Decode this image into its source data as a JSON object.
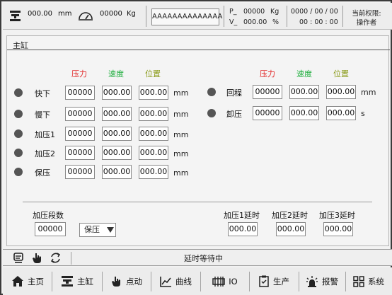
{
  "header": {
    "pressure_value": "000.00",
    "pressure_unit": "mm",
    "weight_value": "00000",
    "weight_unit": "Kg",
    "model_name": "AAAAAAAAAAAAAA",
    "p_label": "P_",
    "p_value": "00000",
    "p_unit": "Kg",
    "v_label": "V_",
    "v_value": "000.00",
    "v_unit": "%",
    "date": "0000 / 00 / 00",
    "time": "00 : 00 : 00",
    "permission_label": "当前权限:",
    "permission_value": "操作者"
  },
  "panel": {
    "title": "主缸",
    "col_pressure": "压力",
    "col_speed": "速度",
    "col_position": "位置",
    "left_rows": [
      {
        "label": "快下",
        "pressure": "00000",
        "speed": "000.00",
        "position": "000.00",
        "unit": "mm"
      },
      {
        "label": "慢下",
        "pressure": "00000",
        "speed": "000.00",
        "position": "000.00",
        "unit": "mm"
      },
      {
        "label": "加压1",
        "pressure": "00000",
        "speed": "000.00",
        "position": "000.00",
        "unit": "mm"
      },
      {
        "label": "加压2",
        "pressure": "00000",
        "speed": "000.00",
        "position": "000.00",
        "unit": "mm"
      },
      {
        "label": "保压",
        "pressure": "00000",
        "speed": "000.00",
        "position": "000.00",
        "unit": "mm"
      }
    ],
    "right_rows": [
      {
        "label": "回程",
        "pressure": "00000",
        "speed": "000.00",
        "position": "000.00",
        "unit": "mm"
      },
      {
        "label": "卸压",
        "pressure": "00000",
        "speed": "000.00",
        "position": "000.00",
        "unit": "s"
      }
    ],
    "press_stages_label": "加压段数",
    "press_stages_value": "00000",
    "mode_select": "保压",
    "delay1_label": "加压1延时",
    "delay1_value": "000.00",
    "delay2_label": "加压2延时",
    "delay2_value": "000.00",
    "delay3_label": "加压3延时",
    "delay3_value": "000.00"
  },
  "status": {
    "message": "延时等待中"
  },
  "nav": {
    "home": "主页",
    "main_cylinder": "主缸",
    "jog": "点动",
    "curve": "曲线",
    "io": "IO",
    "production": "生产",
    "alarm": "报警",
    "system": "系统"
  },
  "colors": {
    "pressure_header": "#e22828",
    "speed_header": "#1fae3e",
    "position_header": "#8a9a17",
    "indicator": "#555555"
  }
}
